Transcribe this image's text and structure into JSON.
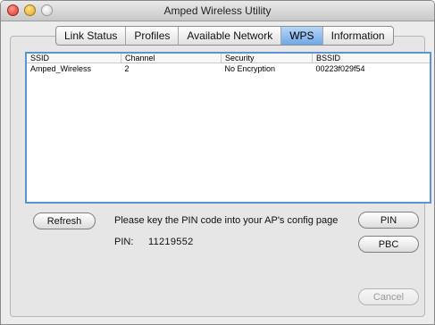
{
  "window": {
    "title": "Amped Wireless Utility"
  },
  "tabs": [
    {
      "label": "Link Status",
      "active": false
    },
    {
      "label": "Profiles",
      "active": false
    },
    {
      "label": "Available Network",
      "active": false
    },
    {
      "label": "WPS",
      "active": true
    },
    {
      "label": "Information",
      "active": false
    }
  ],
  "table": {
    "columns": [
      "SSID",
      "Channel",
      "Security",
      "BSSID"
    ],
    "rows": [
      [
        "Amped_Wireless",
        "2",
        "No Encryption",
        "00223f029f54"
      ]
    ]
  },
  "buttons": {
    "refresh": "Refresh",
    "pin": "PIN",
    "pbc": "PBC",
    "cancel": "Cancel"
  },
  "wps": {
    "instruction": "Please key the PIN code into your AP's config page",
    "pin_label": "PIN:",
    "pin_value": "11219552"
  },
  "colors": {
    "selection_border": "#5b93d6",
    "active_tab": "#6fa8e6"
  }
}
